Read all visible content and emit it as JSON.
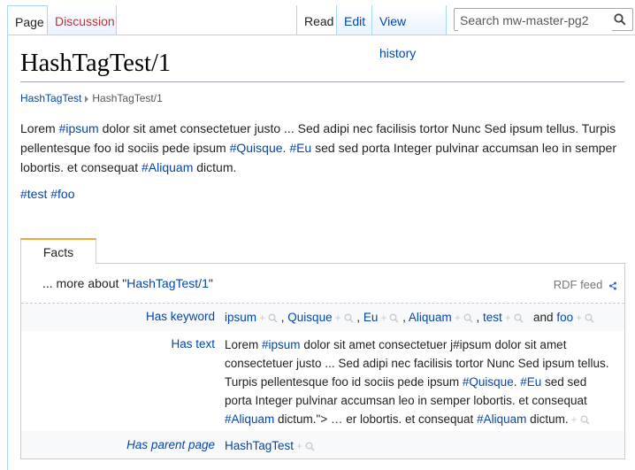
{
  "tabs": {
    "page": "Page",
    "discussion": "Discussion",
    "read": "Read",
    "edit": "Edit",
    "history": "View history"
  },
  "search": {
    "placeholder": "Search mw-master-pg2"
  },
  "page": {
    "title": "HashTagTest/1",
    "breadcrumb": {
      "parent": "HashTagTest",
      "current": "HashTagTest/1"
    }
  },
  "body": {
    "p1": {
      "t1": "Lorem ",
      "l1": "#ipsum",
      "t2": " dolor sit amet consectetuer justo ... Sed adipi nec facilisis tortor Nunc Sed ipsum tellus. Turpis pellentesque foo id sociis pede ipsum ",
      "l2": "#Quisque",
      "t3": ". ",
      "l3": "#Eu",
      "t4": " sed sed porta Integer pulvinar accumsan leo in semper lobortis. et consequat ",
      "l4": "#Aliquam",
      "t5": " dictum."
    },
    "p2": {
      "l1": "#test",
      "l2": "#foo"
    }
  },
  "factbox": {
    "tab": "Facts",
    "title_prefix": "... more about \"",
    "title_link": "HashTagTest/1",
    "title_suffix": "\"",
    "rdf": "RDF feed",
    "keyword": {
      "label": "Has keyword",
      "values": [
        "ipsum",
        "Quisque",
        "Eu",
        "Aliquam",
        "test"
      ],
      "and": "and",
      "last": "foo"
    },
    "text": {
      "label": "Has text",
      "t1": "Lorem ",
      "l1": "#ipsum",
      "t2": " dolor sit amet consectetuer j#ipsum dolor sit amet consectetuer justo ... Sed adipi nec facilisis tortor Nunc Sed ipsum tellus. Turpis pellentesque foo id sociis pede ipsum ",
      "l2": "#Quisque",
      "t3": ". ",
      "l3": "#Eu",
      "t4": " sed sed porta Integer pulvinar accumsan leo in semper lobortis. et consequat ",
      "l4": "#Aliquam",
      "t5": " dictum.\"> … er lobortis. et consequat ",
      "l5": "#Aliquam",
      "t6": " dictum."
    },
    "parent": {
      "label": "Has parent page",
      "value": "HashTagTest"
    }
  },
  "icons": {
    "search": "search-icon",
    "rdf": "share-icon",
    "browse": "magnifier-icon"
  },
  "colors": {
    "link": "#0645ad",
    "new_link": "#ba3434",
    "tab_accent": "#eaa93d"
  }
}
